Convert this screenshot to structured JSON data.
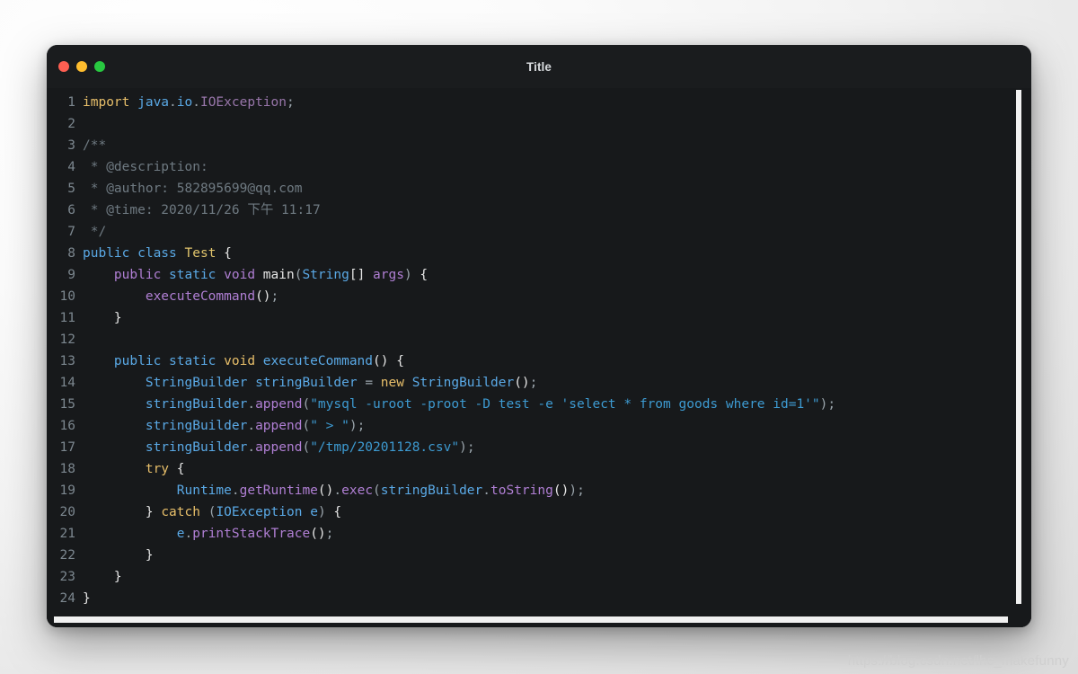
{
  "window": {
    "title": "Title",
    "traffic_lights": [
      {
        "name": "close",
        "color": "#ff5f52"
      },
      {
        "name": "minimize",
        "color": "#ffbd2e"
      },
      {
        "name": "maximize",
        "color": "#28c840"
      }
    ]
  },
  "editor": {
    "language": "java",
    "first_line": 1,
    "last_line": 24,
    "line_numbers": [
      "1",
      "2",
      "3",
      "4",
      "5",
      "6",
      "7",
      "8",
      "9",
      "10",
      "11",
      "12",
      "13",
      "14",
      "15",
      "16",
      "17",
      "18",
      "19",
      "20",
      "21",
      "22",
      "23",
      "24"
    ],
    "lines": [
      {
        "n": "1",
        "text": "import java.io.IOException;"
      },
      {
        "n": "2",
        "text": ""
      },
      {
        "n": "3",
        "text": "/**"
      },
      {
        "n": "4",
        "text": " * @description:"
      },
      {
        "n": "5",
        "text": " * @author: 582895699@qq.com"
      },
      {
        "n": "6",
        "text": " * @time: 2020/11/26 下午 11:17"
      },
      {
        "n": "7",
        "text": " */"
      },
      {
        "n": "8",
        "text": "public class Test {"
      },
      {
        "n": "9",
        "text": "    public static void main(String[] args) {"
      },
      {
        "n": "10",
        "text": "        executeCommand();"
      },
      {
        "n": "11",
        "text": "    }"
      },
      {
        "n": "12",
        "text": ""
      },
      {
        "n": "13",
        "text": "    public static void executeCommand() {"
      },
      {
        "n": "14",
        "text": "        StringBuilder stringBuilder = new StringBuilder();"
      },
      {
        "n": "15",
        "text": "        stringBuilder.append(\"mysql -uroot -proot -D test -e 'select * from goods where id=1'\");"
      },
      {
        "n": "16",
        "text": "        stringBuilder.append(\" > \");"
      },
      {
        "n": "17",
        "text": "        stringBuilder.append(\"/tmp/20201128.csv\");"
      },
      {
        "n": "18",
        "text": "        try {"
      },
      {
        "n": "19",
        "text": "            Runtime.getRuntime().exec(stringBuilder.toString());"
      },
      {
        "n": "20",
        "text": "        } catch (IOException e) {"
      },
      {
        "n": "21",
        "text": "            e.printStackTrace();"
      },
      {
        "n": "22",
        "text": "        }"
      },
      {
        "n": "23",
        "text": "    }"
      },
      {
        "n": "24",
        "text": "}"
      }
    ],
    "tokens": [
      [
        {
          "t": "import ",
          "c": "t-kw-o"
        },
        {
          "t": "java",
          "c": "t-ident"
        },
        {
          "t": ".",
          "c": "t-punc"
        },
        {
          "t": "io",
          "c": "t-ident"
        },
        {
          "t": ".",
          "c": "t-punc"
        },
        {
          "t": "IOException",
          "c": "t-cls"
        },
        {
          "t": ";",
          "c": "t-punc"
        }
      ],
      [
        {
          "t": "",
          "c": "t-plain"
        }
      ],
      [
        {
          "t": "/**",
          "c": "t-comment"
        }
      ],
      [
        {
          "t": " * @description:",
          "c": "t-comment"
        }
      ],
      [
        {
          "t": " * @author: 582895699@qq.com",
          "c": "t-comment"
        }
      ],
      [
        {
          "t": " * @time: 2020/11/26 下午 11:17",
          "c": "t-comment"
        }
      ],
      [
        {
          "t": " */",
          "c": "t-comment"
        }
      ],
      [
        {
          "t": "public ",
          "c": "t-kw-b"
        },
        {
          "t": "class ",
          "c": "t-kw-b"
        },
        {
          "t": "Test",
          "c": "t-name"
        },
        {
          "t": " {",
          "c": "t-plain"
        }
      ],
      [
        {
          "t": "    ",
          "c": "t-plain"
        },
        {
          "t": "public ",
          "c": "t-kw-p"
        },
        {
          "t": "static ",
          "c": "t-kw-b"
        },
        {
          "t": "void ",
          "c": "t-kw-p"
        },
        {
          "t": "main",
          "c": "t-plain"
        },
        {
          "t": "(",
          "c": "t-punc"
        },
        {
          "t": "String",
          "c": "t-type"
        },
        {
          "t": "[] ",
          "c": "t-plain"
        },
        {
          "t": "args",
          "c": "t-kw-p"
        },
        {
          "t": ")",
          "c": "t-punc"
        },
        {
          "t": " {",
          "c": "t-plain"
        }
      ],
      [
        {
          "t": "        ",
          "c": "t-plain"
        },
        {
          "t": "executeCommand",
          "c": "t-fn"
        },
        {
          "t": "()",
          "c": "t-plain"
        },
        {
          "t": ";",
          "c": "t-punc"
        }
      ],
      [
        {
          "t": "    }",
          "c": "t-plain"
        }
      ],
      [
        {
          "t": "",
          "c": "t-plain"
        }
      ],
      [
        {
          "t": "    ",
          "c": "t-plain"
        },
        {
          "t": "public ",
          "c": "t-kw-b"
        },
        {
          "t": "static ",
          "c": "t-kw-b"
        },
        {
          "t": "void ",
          "c": "t-kw-o"
        },
        {
          "t": "executeCommand",
          "c": "t-ident"
        },
        {
          "t": "()",
          "c": "t-plain"
        },
        {
          "t": " {",
          "c": "t-plain"
        }
      ],
      [
        {
          "t": "        ",
          "c": "t-plain"
        },
        {
          "t": "StringBuilder",
          "c": "t-type"
        },
        {
          "t": " ",
          "c": "t-plain"
        },
        {
          "t": "stringBuilder",
          "c": "t-ident"
        },
        {
          "t": " ",
          "c": "t-plain"
        },
        {
          "t": "=",
          "c": "t-punc"
        },
        {
          "t": " ",
          "c": "t-plain"
        },
        {
          "t": "new ",
          "c": "t-kw-o"
        },
        {
          "t": "StringBuilder",
          "c": "t-type"
        },
        {
          "t": "()",
          "c": "t-plain"
        },
        {
          "t": ";",
          "c": "t-punc"
        }
      ],
      [
        {
          "t": "        ",
          "c": "t-plain"
        },
        {
          "t": "stringBuilder",
          "c": "t-ident"
        },
        {
          "t": ".",
          "c": "t-punc"
        },
        {
          "t": "append",
          "c": "t-fn"
        },
        {
          "t": "(",
          "c": "t-punc"
        },
        {
          "t": "\"mysql -uroot -proot -D test -e 'select * from goods where id=1'\"",
          "c": "t-str"
        },
        {
          "t": ")",
          "c": "t-punc"
        },
        {
          "t": ";",
          "c": "t-punc"
        }
      ],
      [
        {
          "t": "        ",
          "c": "t-plain"
        },
        {
          "t": "stringBuilder",
          "c": "t-ident"
        },
        {
          "t": ".",
          "c": "t-punc"
        },
        {
          "t": "append",
          "c": "t-fn"
        },
        {
          "t": "(",
          "c": "t-punc"
        },
        {
          "t": "\" > \"",
          "c": "t-str"
        },
        {
          "t": ")",
          "c": "t-punc"
        },
        {
          "t": ";",
          "c": "t-punc"
        }
      ],
      [
        {
          "t": "        ",
          "c": "t-plain"
        },
        {
          "t": "stringBuilder",
          "c": "t-ident"
        },
        {
          "t": ".",
          "c": "t-punc"
        },
        {
          "t": "append",
          "c": "t-fn"
        },
        {
          "t": "(",
          "c": "t-punc"
        },
        {
          "t": "\"/tmp/20201128.csv\"",
          "c": "t-str"
        },
        {
          "t": ")",
          "c": "t-punc"
        },
        {
          "t": ";",
          "c": "t-punc"
        }
      ],
      [
        {
          "t": "        ",
          "c": "t-plain"
        },
        {
          "t": "try",
          "c": "t-kw-o"
        },
        {
          "t": " {",
          "c": "t-plain"
        }
      ],
      [
        {
          "t": "            ",
          "c": "t-plain"
        },
        {
          "t": "Runtime",
          "c": "t-type"
        },
        {
          "t": ".",
          "c": "t-punc"
        },
        {
          "t": "getRuntime",
          "c": "t-fn"
        },
        {
          "t": "()",
          "c": "t-plain"
        },
        {
          "t": ".",
          "c": "t-punc"
        },
        {
          "t": "exec",
          "c": "t-fn"
        },
        {
          "t": "(",
          "c": "t-punc"
        },
        {
          "t": "stringBuilder",
          "c": "t-ident"
        },
        {
          "t": ".",
          "c": "t-punc"
        },
        {
          "t": "toString",
          "c": "t-fn"
        },
        {
          "t": "()",
          "c": "t-plain"
        },
        {
          "t": ")",
          "c": "t-punc"
        },
        {
          "t": ";",
          "c": "t-punc"
        }
      ],
      [
        {
          "t": "        }",
          "c": "t-plain"
        },
        {
          "t": " ",
          "c": "t-plain"
        },
        {
          "t": "catch",
          "c": "t-kw-o"
        },
        {
          "t": " ",
          "c": "t-plain"
        },
        {
          "t": "(",
          "c": "t-punc"
        },
        {
          "t": "IOException",
          "c": "t-type"
        },
        {
          "t": " ",
          "c": "t-plain"
        },
        {
          "t": "e",
          "c": "t-ident"
        },
        {
          "t": ")",
          "c": "t-punc"
        },
        {
          "t": " {",
          "c": "t-plain"
        }
      ],
      [
        {
          "t": "            ",
          "c": "t-plain"
        },
        {
          "t": "e",
          "c": "t-ident"
        },
        {
          "t": ".",
          "c": "t-punc"
        },
        {
          "t": "printStackTrace",
          "c": "t-fn"
        },
        {
          "t": "()",
          "c": "t-plain"
        },
        {
          "t": ";",
          "c": "t-punc"
        }
      ],
      [
        {
          "t": "        }",
          "c": "t-plain"
        }
      ],
      [
        {
          "t": "    }",
          "c": "t-plain"
        }
      ],
      [
        {
          "t": "}",
          "c": "t-plain"
        }
      ]
    ]
  },
  "scrollbars": {
    "vertical_visible": true,
    "horizontal_visible": true
  },
  "watermark": {
    "text": "https://blog.csdn.net/lhc_makefunny"
  }
}
